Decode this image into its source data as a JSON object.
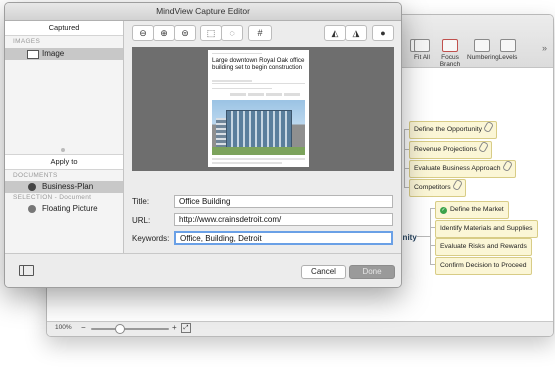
{
  "dialog": {
    "title": "MindView Capture Editor",
    "sidebar": {
      "captured_header": "Captured",
      "images_section": "IMAGES",
      "image_item": "Image",
      "apply_to_header": "Apply to",
      "documents_section": "DOCUMENTS",
      "document_item": "Business-Plan",
      "selection_section": "SELECTION - Document",
      "selection_item": "Floating Picture"
    },
    "tools": [
      {
        "icon": "zoom-out-icon",
        "glyph": "⊖"
      },
      {
        "icon": "zoom-in-icon",
        "glyph": "⊕"
      },
      {
        "icon": "zoom-fit-icon",
        "glyph": "⊜"
      },
      {
        "icon": "crop-rect-icon",
        "glyph": "⬚"
      },
      {
        "icon": "crop-ellipse-icon",
        "glyph": "◌"
      },
      {
        "icon": "crop-icon",
        "glyph": "#"
      },
      {
        "icon": "flip-horizontal-icon",
        "glyph": "◭"
      },
      {
        "icon": "flip-vertical-icon",
        "glyph": "◮"
      },
      {
        "icon": "ink-drop-icon",
        "glyph": "●"
      }
    ],
    "preview": {
      "headline": "Large downtown Royal Oak office building set to begin construction"
    },
    "fields": {
      "title_label": "Title:",
      "title_value": "Office Building",
      "url_label": "URL:",
      "url_value": "http://www.crainsdetroit.com/",
      "keywords_label": "Keywords:",
      "keywords_value": "Office, Building, Detroit"
    },
    "buttons": {
      "cancel": "Cancel",
      "done": "Done"
    }
  },
  "background_app": {
    "toolbar": [
      {
        "label": "Fit All"
      },
      {
        "label": "Focus Branch"
      },
      {
        "label": "Numbering"
      },
      {
        "label": "Levels"
      }
    ],
    "central_topic": "tunity",
    "nodes_top": [
      "Define the Opportunity",
      "Revenue Projections",
      "Evaluate Business Approach",
      "Competitors"
    ],
    "nodes_bottom": [
      "Define the Market",
      "Identify Materials and Supplies",
      "Evaluate Risks and Rewards",
      "Confirm Decision to Proceed"
    ],
    "status": {
      "zoom": "100%"
    }
  },
  "colors": {
    "node_fill": "#fbf6d6",
    "node_border": "#d8cc86",
    "check_green": "#3aa24a",
    "focus_blue": "#6aa0e6"
  }
}
